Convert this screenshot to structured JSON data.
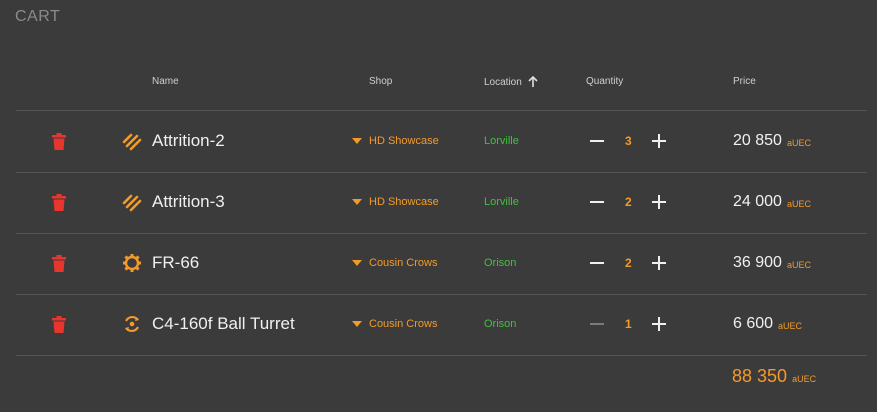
{
  "title": "CART",
  "headers": {
    "name": "Name",
    "shop": "Shop",
    "location": "Location",
    "quantity": "Quantity",
    "price": "Price"
  },
  "rows": [
    {
      "name": "Attrition-2",
      "icon": "laser-icon",
      "shop": "HD Showcase",
      "location": "Lorville",
      "qty": "3",
      "price": "20 850",
      "currency": "aUEC",
      "minus_enabled": true
    },
    {
      "name": "Attrition-3",
      "icon": "laser-icon",
      "shop": "HD Showcase",
      "location": "Lorville",
      "qty": "2",
      "price": "24 000",
      "currency": "aUEC",
      "minus_enabled": true
    },
    {
      "name": "FR-66",
      "icon": "shield-gear-icon",
      "shop": "Cousin Crows",
      "location": "Orison",
      "qty": "2",
      "price": "36 900",
      "currency": "aUEC",
      "minus_enabled": true
    },
    {
      "name": "C4-160f Ball Turret",
      "icon": "turret-icon",
      "shop": "Cousin Crows",
      "location": "Orison",
      "qty": "1",
      "price": "6 600",
      "currency": "aUEC",
      "minus_enabled": false
    }
  ],
  "total": {
    "amount": "88 350",
    "currency": "aUEC"
  },
  "colors": {
    "accent": "#f39a2a",
    "location": "#3ec23e",
    "delete": "#e8362f",
    "background": "#3b3b3b"
  }
}
